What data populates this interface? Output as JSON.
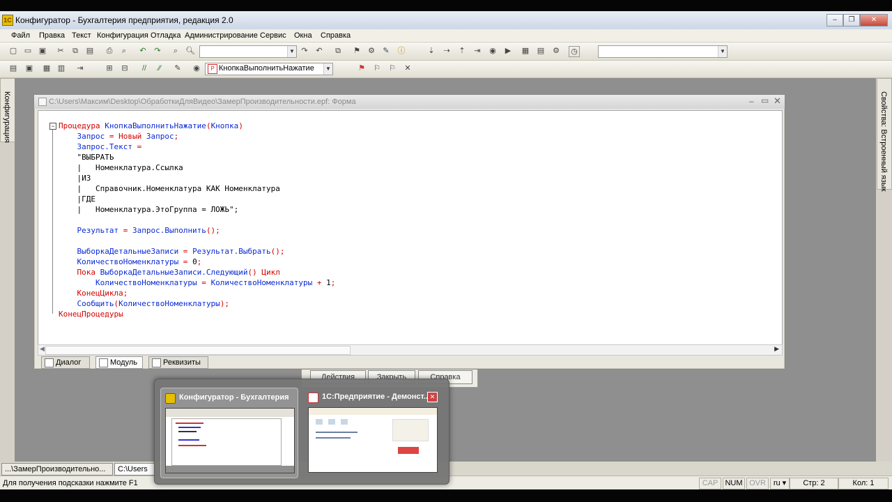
{
  "window": {
    "title": "Конфигуратор - Бухгалтерия предприятия, редакция 2.0",
    "logo": "1c-configurator-icon"
  },
  "menu": [
    "Файл",
    "Правка",
    "Текст",
    "Конфигурация",
    "Отладка",
    "Администрирование",
    "Сервис",
    "Окна",
    "Справка"
  ],
  "toolbar2": {
    "event_combo": "КнопкаВыполнитьНажатие"
  },
  "left_panel_label": "Конфигурация",
  "right_panel_label": "Свойства: Встроенный язык",
  "editor": {
    "title": "C:\\Users\\Максим\\Desktop\\ОбработкиДляВидео\\ЗамерПроизводительности.epf: Форма",
    "code": [
      [
        {
          "c": "kw",
          "t": "Процедура "
        },
        {
          "c": "id",
          "t": "КнопкаВыполнитьНажатие"
        },
        {
          "c": "op",
          "t": "("
        },
        {
          "c": "id",
          "t": "Кнопка"
        },
        {
          "c": "op",
          "t": ")"
        }
      ],
      [
        {
          "c": "id",
          "t": "    Запрос"
        },
        {
          "c": "op",
          "t": " = "
        },
        {
          "c": "kw",
          "t": "Новый "
        },
        {
          "c": "id",
          "t": "Запрос"
        },
        {
          "c": "op",
          "t": ";"
        }
      ],
      [
        {
          "c": "id",
          "t": "    Запрос.Текст"
        },
        {
          "c": "op",
          "t": " ="
        }
      ],
      [
        {
          "c": "tx",
          "t": "    \"ВЫБРАТЬ"
        }
      ],
      [
        {
          "c": "tx",
          "t": "    |   Номенклатура.Ссылка"
        }
      ],
      [
        {
          "c": "tx",
          "t": "    |ИЗ"
        }
      ],
      [
        {
          "c": "tx",
          "t": "    |   Справочник.Номенклатура КАК Номенклатура"
        }
      ],
      [
        {
          "c": "tx",
          "t": "    |ГДЕ"
        }
      ],
      [
        {
          "c": "tx",
          "t": "    |   Номенклатура.ЭтоГруппа = ЛОЖЬ\";"
        }
      ],
      [],
      [
        {
          "c": "id",
          "t": "    Результат"
        },
        {
          "c": "op",
          "t": " = "
        },
        {
          "c": "id",
          "t": "Запрос.Выполнить"
        },
        {
          "c": "op",
          "t": "();"
        }
      ],
      [],
      [
        {
          "c": "id",
          "t": "    ВыборкаДетальныеЗаписи"
        },
        {
          "c": "op",
          "t": " = "
        },
        {
          "c": "id",
          "t": "Результат.Выбрать"
        },
        {
          "c": "op",
          "t": "();"
        }
      ],
      [
        {
          "c": "id",
          "t": "    КоличествоНоменклатуры"
        },
        {
          "c": "op",
          "t": " = "
        },
        {
          "c": "tx",
          "t": "0"
        },
        {
          "c": "op",
          "t": ";"
        }
      ],
      [
        {
          "c": "kw",
          "t": "    Пока "
        },
        {
          "c": "id",
          "t": "ВыборкаДетальныеЗаписи.Следующий"
        },
        {
          "c": "op",
          "t": "() "
        },
        {
          "c": "kw",
          "t": "Цикл"
        }
      ],
      [
        {
          "c": "id",
          "t": "        КоличествоНоменклатуры"
        },
        {
          "c": "op",
          "t": " = "
        },
        {
          "c": "id",
          "t": "КоличествоНоменклатуры"
        },
        {
          "c": "op",
          "t": " + "
        },
        {
          "c": "tx",
          "t": "1"
        },
        {
          "c": "op",
          "t": ";"
        }
      ],
      [
        {
          "c": "kw",
          "t": "    КонецЦикла"
        },
        {
          "c": "op",
          "t": ";"
        }
      ],
      [
        {
          "c": "id",
          "t": "    Сообщить"
        },
        {
          "c": "op",
          "t": "("
        },
        {
          "c": "id",
          "t": "КоличествоНоменклатуры"
        },
        {
          "c": "op",
          "t": ");"
        }
      ],
      [
        {
          "c": "kw",
          "t": "КонецПроцедуры"
        }
      ]
    ],
    "tabs": [
      "Диалог",
      "Модуль",
      "Реквизиты"
    ],
    "active_tab": "Модуль"
  },
  "dialog_buttons": [
    "Действия",
    "Закрыть",
    "Справка"
  ],
  "alt_tab": {
    "items": [
      {
        "title": "Конфигуратор - Бухгалтерия п...",
        "selected": true
      },
      {
        "title": "1С:Предприятие - Демонст..."
      }
    ]
  },
  "window_strip": [
    "...\\ЗамерПроизводительно...",
    "C:\\Users"
  ],
  "status": {
    "hint": "Для получения подсказки нажмите F1",
    "cap": "CAP",
    "num": "NUM",
    "ovr": "OVR",
    "lang": "ru",
    "line": "Стр: 2",
    "col": "Кол: 1"
  }
}
